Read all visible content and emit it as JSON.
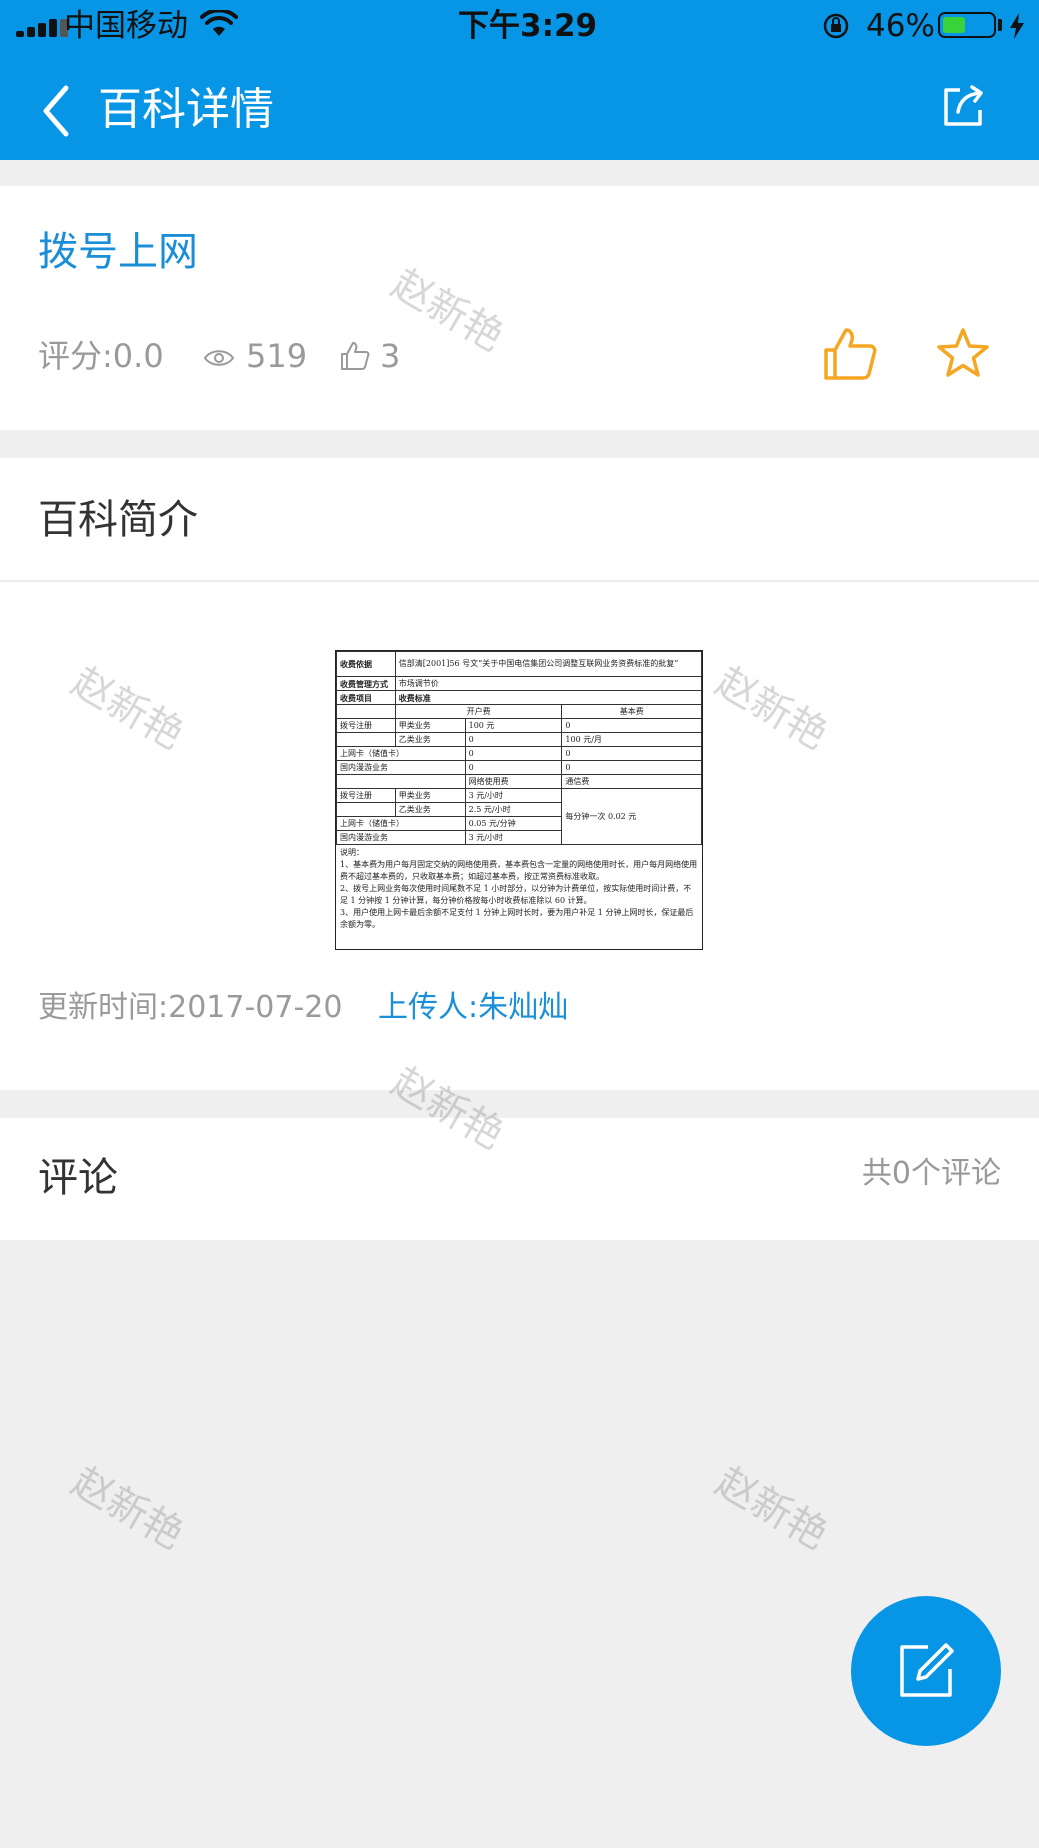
{
  "status_bar": {
    "carrier": "中国移动",
    "time": "下午3:29",
    "battery_percent": "46%",
    "battery_level": 0.46
  },
  "nav": {
    "title": "百科详情",
    "back_icon": "chevron-left-icon",
    "share_icon": "share-icon"
  },
  "article": {
    "title": "拨号上网",
    "rating": "评分:0.0",
    "views": "519",
    "likes": "3",
    "like_icon": "thumbs-up-icon",
    "favorite_icon": "star-icon"
  },
  "intro": {
    "heading": "百科简介",
    "document": {
      "rows": [
        [
          "收费依据",
          "信部清[2001]56 号文“关于中国电信集团公司调整互联网业务资费标准的批复”"
        ],
        [
          "收费管理方式",
          "市场调节价"
        ],
        [
          "收费项目",
          "收费标准"
        ]
      ],
      "header_cols": [
        "开户费",
        "基本费"
      ],
      "fee_rows": [
        [
          "拨号注册",
          "甲类业务",
          "100 元",
          "0"
        ],
        [
          "",
          "乙类业务",
          "0",
          "100 元/月"
        ],
        [
          "上网卡（储值卡）",
          "",
          "0",
          "0"
        ],
        [
          "国内漫游业务",
          "",
          "0",
          "0"
        ]
      ],
      "usage_cols": [
        "网络使用费",
        "通信费"
      ],
      "usage_rows": [
        [
          "拨号注册",
          "甲类业务",
          "3 元/小时"
        ],
        [
          "",
          "乙类业务",
          "2.5 元/小时"
        ],
        [
          "上网卡（储值卡）",
          "",
          "0.05 元/分钟"
        ],
        [
          "国内漫游业务",
          "",
          "3 元/小时"
        ]
      ],
      "comm_fee": "每分钟一次 0.02 元",
      "notes": "说明：\n1、基本费为用户每月固定交纳的网络使用费，基本费包含一定量的网络使用时长，用户每月网络使用费不超过基本费的，只收取基本费；如超过基本费，按正常资费标准收取。\n2、拨号上网业务每次使用时间尾数不足 1 小时部分，以分钟为计费单位，按实际使用时间计费，不足 1 分钟按 1 分钟计算，每分钟价格按每小时收费标准除以 60 计算。\n3、用户使用上网卡最后余额不足支付 1 分钟上网时长时，要为用户补足 1 分钟上网时长，保证最后余额为零。"
    },
    "update_time": "更新时间:2017-07-20",
    "uploader": "上传人:朱灿灿"
  },
  "comments": {
    "heading": "评论",
    "count": "共0个评论"
  },
  "fab_icon": "edit-icon",
  "watermark": "赵新艳",
  "colors": {
    "primary": "#0795e6",
    "link": "#1a8fd8",
    "accent_orange": "#f5a623",
    "background": "#efefef"
  }
}
